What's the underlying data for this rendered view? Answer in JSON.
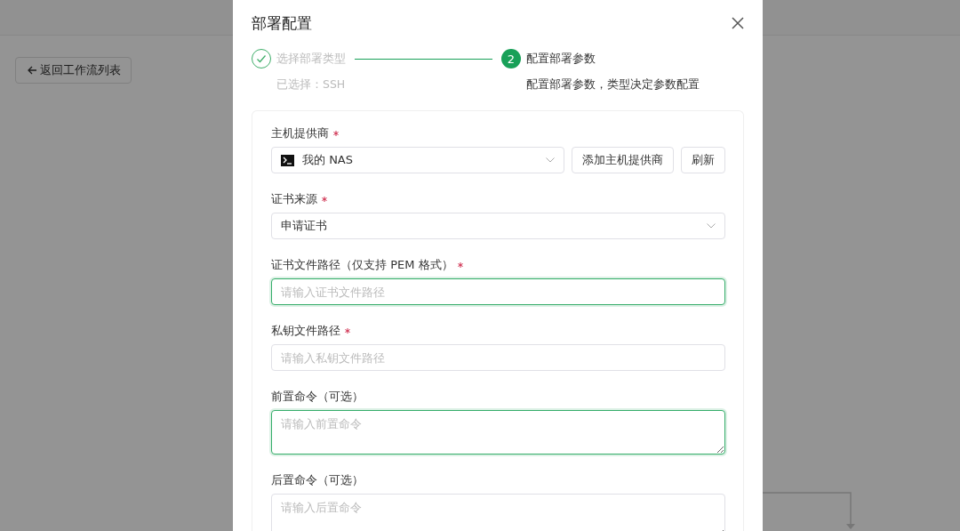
{
  "page": {
    "back_button": "返回工作流列表"
  },
  "dialog": {
    "title": "部署配置",
    "steps": [
      {
        "completed": true,
        "title": "选择部署类型",
        "description": "已选择：SSH"
      },
      {
        "completed": false,
        "number": "2",
        "title": "配置部署参数",
        "description": "配置部署参数，类型决定参数配置"
      }
    ],
    "fields": [
      {
        "kind": "select",
        "label": "主机提供商",
        "required": true,
        "value": "我的 NAS",
        "has_icon": true,
        "focused": false,
        "buttons": [
          "添加主机提供商",
          "刷新"
        ]
      },
      {
        "kind": "select",
        "label": "证书来源",
        "required": true,
        "value": "申请证书",
        "has_icon": false,
        "focused": false
      },
      {
        "kind": "input",
        "label": "证书文件路径（仅支持 PEM 格式）",
        "required": true,
        "placeholder": "请输入证书文件路径",
        "focused": true
      },
      {
        "kind": "input",
        "label": "私钥文件路径",
        "required": true,
        "placeholder": "请输入私钥文件路径",
        "focused": false
      },
      {
        "kind": "textarea",
        "label": "前置命令（可选）",
        "required": false,
        "placeholder": "请输入前置命令",
        "focused": true
      },
      {
        "kind": "textarea",
        "label": "后置命令（可选）",
        "required": false,
        "placeholder": "请输入后置命令",
        "focused": false
      }
    ]
  }
}
